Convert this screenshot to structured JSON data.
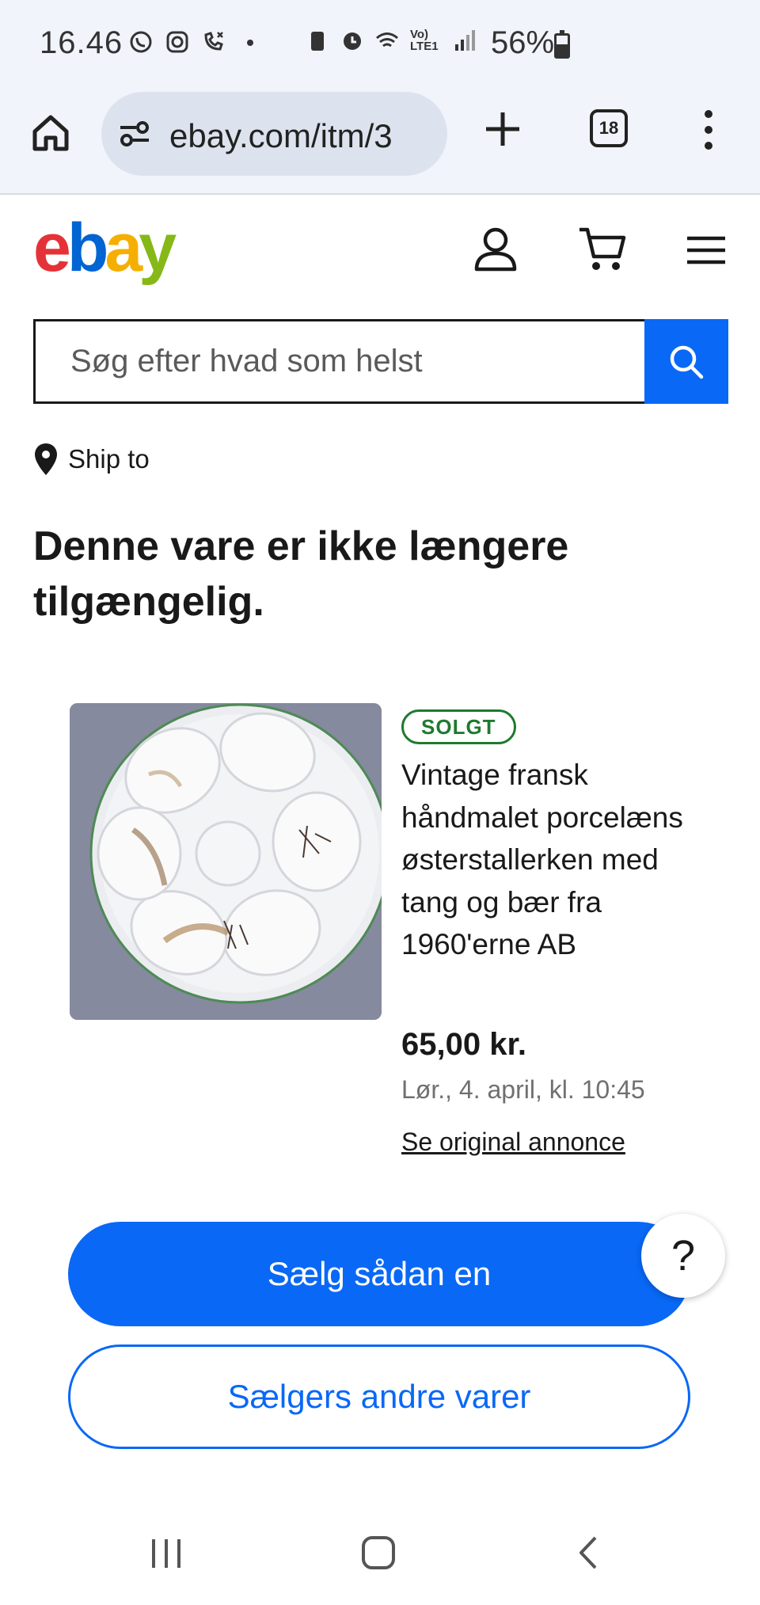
{
  "status_bar": {
    "time": "16.46",
    "battery_percent": "56%",
    "network_label": "Vo) LTE1",
    "battery_level": 0.56
  },
  "browser": {
    "url": "ebay.com/itm/3",
    "tab_count": "18"
  },
  "header": {
    "logo": {
      "e": "e",
      "b": "b",
      "a": "a",
      "y": "y"
    },
    "icons": [
      "user-icon",
      "cart-icon",
      "menu-icon"
    ]
  },
  "search": {
    "placeholder": "Søg efter hvad som helst",
    "value": ""
  },
  "ship_to": "Ship to",
  "headline": "Denne vare er ikke længere tilgængelig.",
  "item": {
    "badge": "SOLGT",
    "title": "Vintage fransk håndmalet porcelæns østerstallerken med tang og bær fra 1960'erne AB",
    "price": "65,00 kr.",
    "date": "Lør., 4. april, kl. 10:45",
    "link": "Se original annonce"
  },
  "buttons": {
    "sell": "Sælg sådan en",
    "seller_items": "Sælgers andre varer",
    "help": "?"
  },
  "colors": {
    "accent": "#0968f6",
    "sold_badge": "#1e7a2f",
    "logo_red": "#e53238",
    "logo_blue": "#0064d2",
    "logo_yellow": "#f5af02",
    "logo_green": "#86b817"
  }
}
